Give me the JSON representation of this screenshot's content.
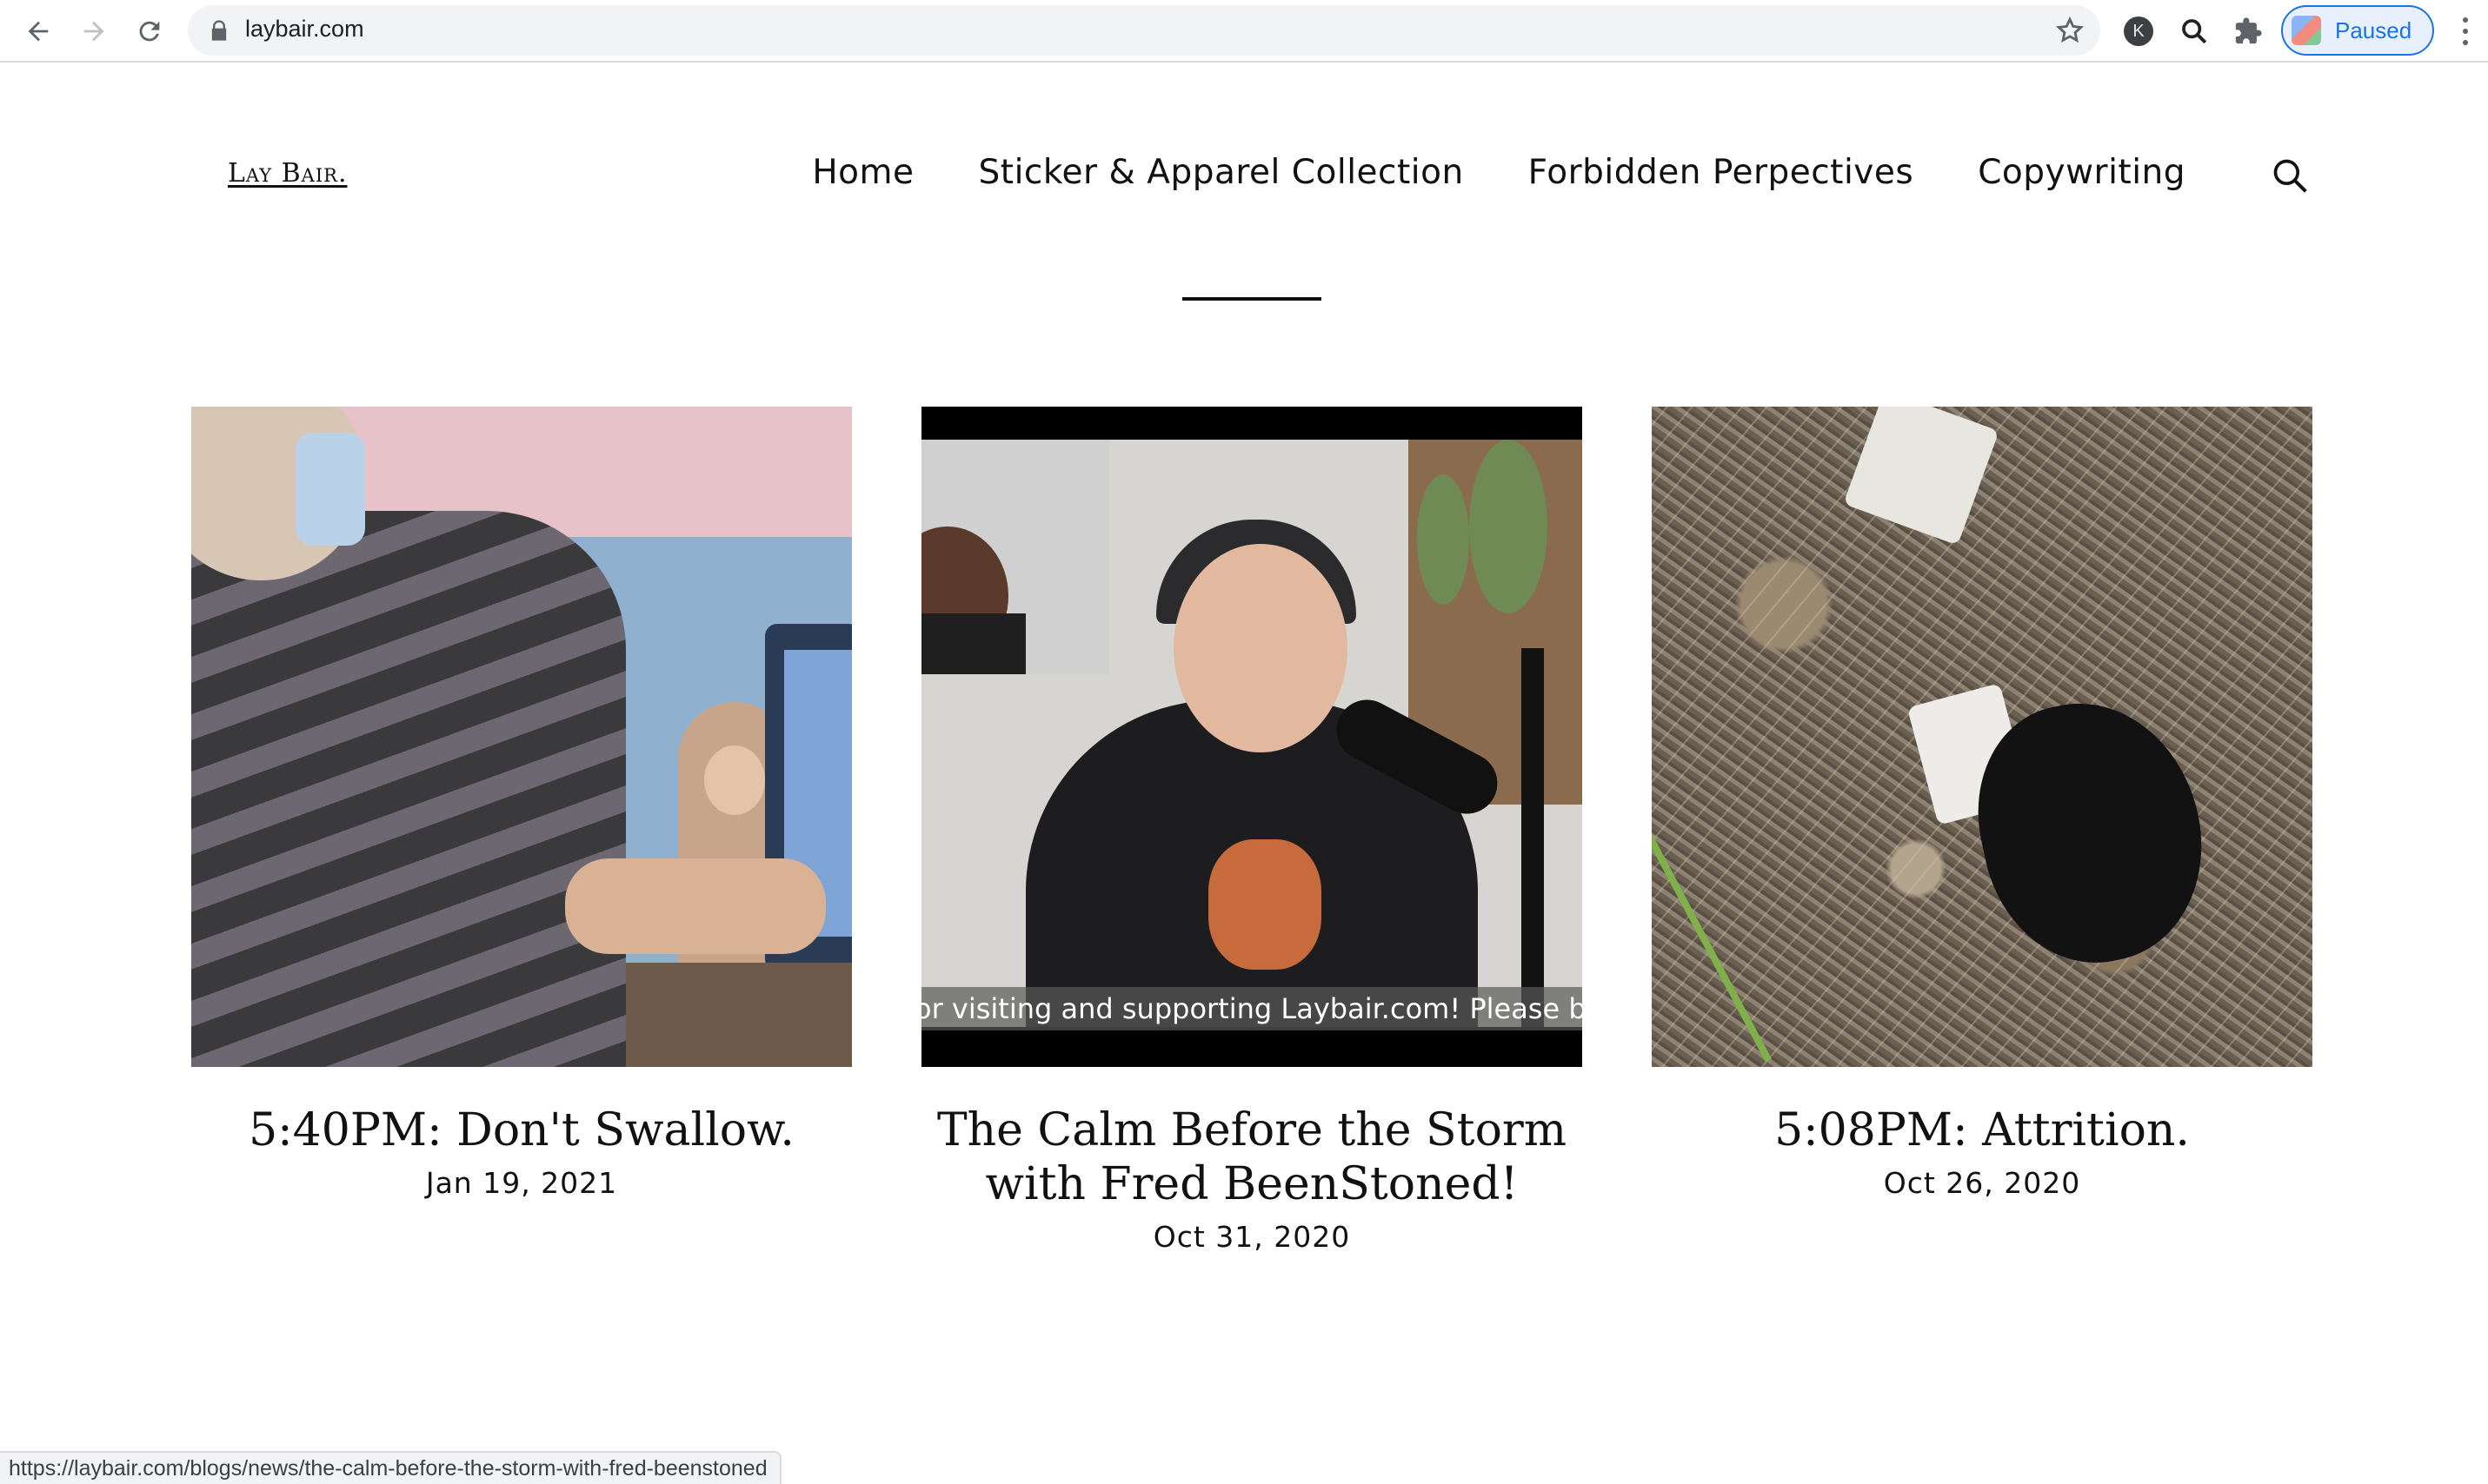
{
  "browser": {
    "url": "laybair.com",
    "profile_initial": "K",
    "profile_status": "Paused"
  },
  "site": {
    "logo": "Lay Bair.",
    "nav": [
      "Home",
      "Sticker & Apparel Collection",
      "Forbidden Perpectives",
      "Copywriting"
    ]
  },
  "posts": [
    {
      "title": "5:40PM: Don't Swallow.",
      "date": "Jan 19, 2021"
    },
    {
      "title": "The Calm Before the Storm with Fred BeenStoned!",
      "date": "Oct 31, 2020",
      "thumb_caption": "or visiting and supporting Laybair.com! Please be"
    },
    {
      "title": "5:08PM: Attrition.",
      "date": "Oct 26, 2020"
    }
  ],
  "status_bar": {
    "link_preview": "https://laybair.com/blogs/news/the-calm-before-the-storm-with-fred-beenstoned"
  }
}
